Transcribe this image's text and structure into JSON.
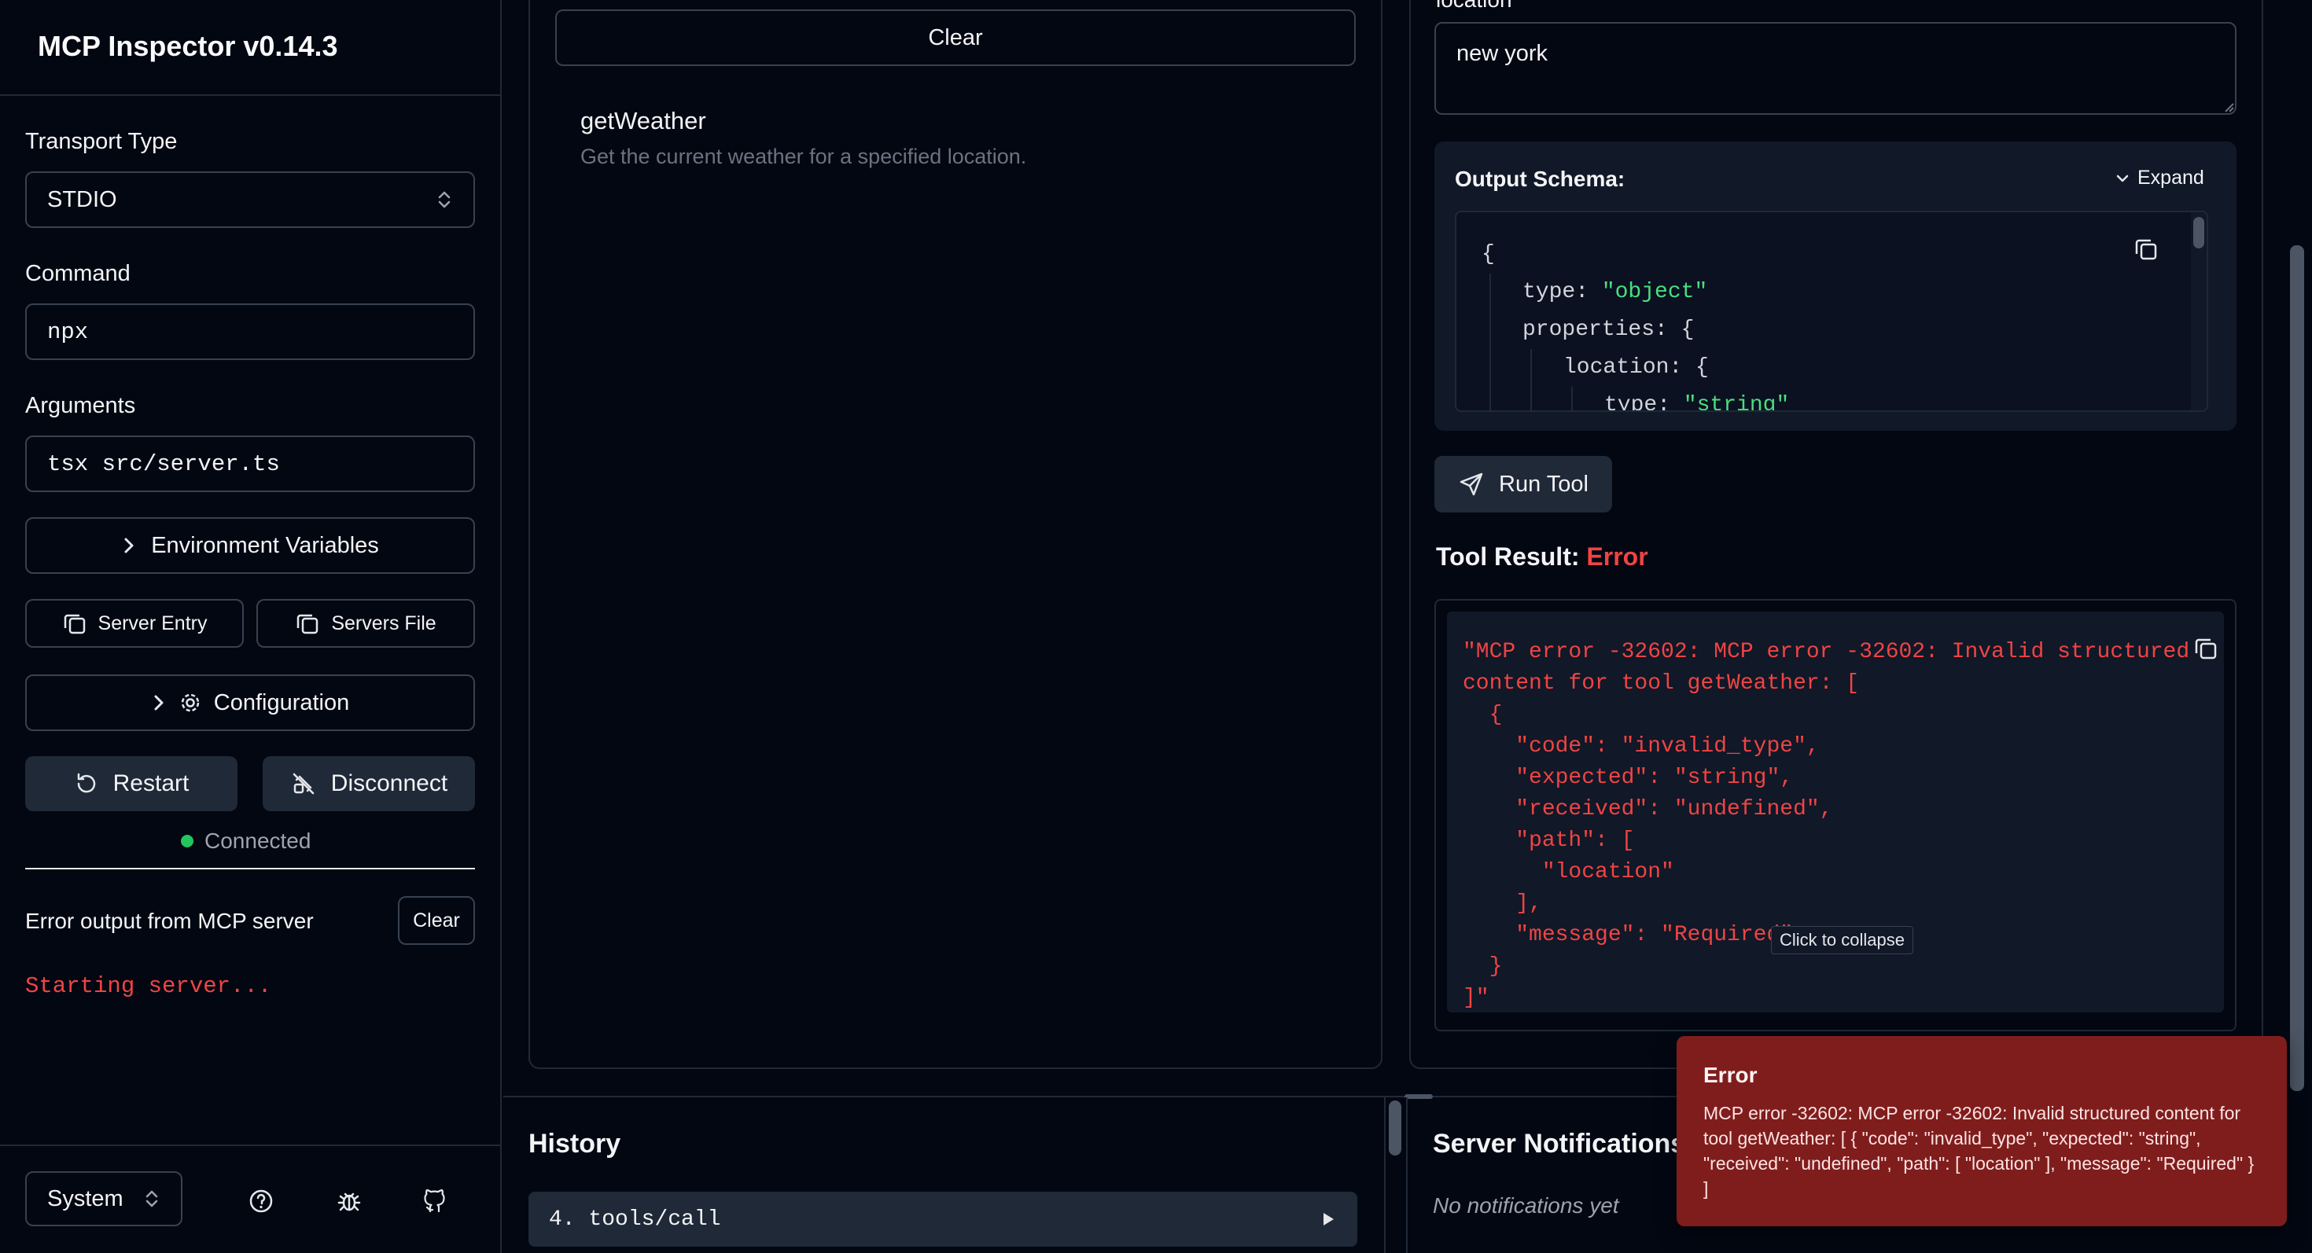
{
  "sidebar": {
    "title": "MCP Inspector v0.14.3",
    "transport": {
      "label": "Transport Type",
      "value": "STDIO"
    },
    "command": {
      "label": "Command",
      "value": "npx"
    },
    "arguments": {
      "label": "Arguments",
      "value": "tsx src/server.ts"
    },
    "env_button": "Environment Variables",
    "server_entry_button": "Server Entry",
    "servers_file_button": "Servers File",
    "configuration_button": "Configuration",
    "restart_button": "Restart",
    "disconnect_button": "Disconnect",
    "status": "Connected",
    "status_color": "#22c55e",
    "error_output_label": "Error output from MCP server",
    "error_clear_button": "Clear",
    "error_log": "Starting server...",
    "theme_select": "System",
    "footer_icons": [
      "help-circle-icon",
      "bug-icon",
      "github-icon"
    ]
  },
  "tools_panel": {
    "clear_button": "Clear",
    "tool_name": "getWeather",
    "tool_description": "Get the current weather for a specified location."
  },
  "tool_detail": {
    "location_label": "location",
    "location_value": "new york",
    "output_schema_label": "Output Schema:",
    "expand_button": "Expand",
    "schema_lines": [
      {
        "indent": 0,
        "key": "",
        "value": "{"
      },
      {
        "indent": 1,
        "key": "type:",
        "value": "\"object\""
      },
      {
        "indent": 1,
        "key": "properties:",
        "value": "{"
      },
      {
        "indent": 2,
        "key": "location:",
        "value": "{"
      },
      {
        "indent": 3,
        "key": "type:",
        "value": "\"string\""
      }
    ],
    "run_tool_button": "Run Tool",
    "result_label": "Tool Result:",
    "result_status": "Error",
    "result_lines": [
      "\"MCP error -32602: MCP error -32602: Invalid structured",
      "content for tool getWeather: [",
      "  {",
      "    \"code\": \"invalid_type\",",
      "    \"expected\": \"string\",",
      "    \"received\": \"undefined\",",
      "    \"path\": [",
      "      \"location\"",
      "    ],",
      "    \"message\": \"Required\"",
      "  }",
      "]\""
    ],
    "tooltip": "Click to collapse"
  },
  "history": {
    "title": "History",
    "items": [
      {
        "label": "4. tools/call"
      }
    ]
  },
  "notifications": {
    "title": "Server Notifications",
    "empty": "No notifications yet"
  },
  "toast": {
    "title": "Error",
    "message": "MCP error -32602: MCP error -32602: Invalid structured content for tool getWeather: [ { \"code\": \"invalid_type\", \"expected\": \"string\", \"received\": \"undefined\", \"path\": [ \"location\" ], \"message\": \"Required\" } ]"
  },
  "colors": {
    "error": "#ef4444",
    "string": "#4ade80"
  }
}
